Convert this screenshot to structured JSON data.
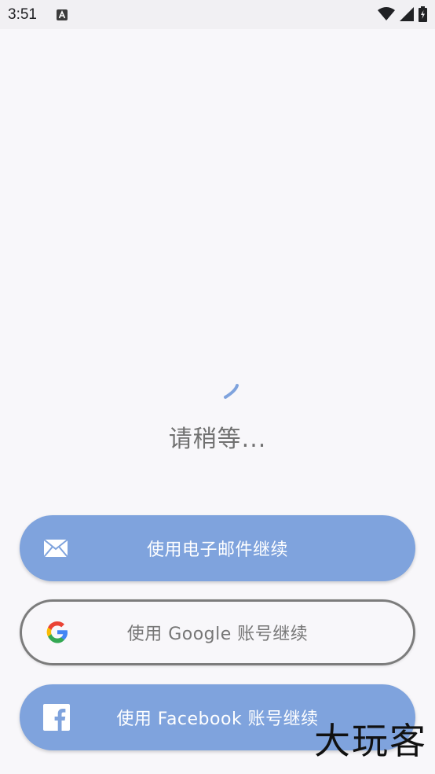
{
  "status_bar": {
    "time": "3:51",
    "notification_icon": "text-a-icon",
    "icons": [
      "wifi-icon",
      "signal-icon",
      "battery-charging-icon"
    ]
  },
  "loading": {
    "text": "请稍等...",
    "spinner_color": "#7fa3dd"
  },
  "buttons": {
    "email": {
      "label": "使用电子邮件继续",
      "icon": "mail-icon"
    },
    "google": {
      "label": "使用 Google 账号继续",
      "icon": "google-logo-icon"
    },
    "facebook": {
      "label": "使用 Facebook 账号继续",
      "icon": "facebook-logo-icon"
    }
  },
  "colors": {
    "primary": "#7fa3dd",
    "background": "#f8f7fa",
    "outline": "#7c7c7c",
    "muted_text": "#707070"
  },
  "watermark": {
    "text": "大玩客"
  }
}
